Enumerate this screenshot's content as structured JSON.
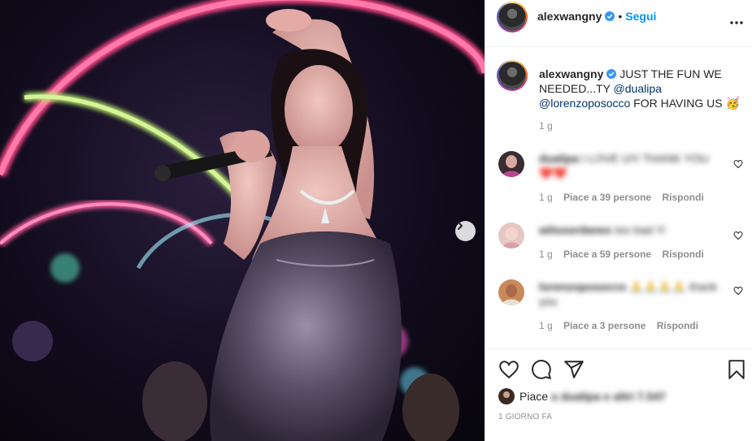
{
  "post": {
    "author": "alexwangny",
    "follow_label": "Segui",
    "separator": "•",
    "caption_text_1": "JUST THE FUN WE NEEDED...TY",
    "caption_mention_1": "@dualipa",
    "caption_mention_2": "@lorenzoposocco",
    "caption_text_2": "FOR HAVING US",
    "caption_emoji": "🥳",
    "caption_time": "1 g",
    "timestamp": "1 GIORNO FA",
    "likes_prefix": "Piace",
    "likes_blurred": "a dualipa e altri 7.547"
  },
  "comments": [
    {
      "user": "dualipa",
      "text": "I LOVE U!!! THANK YOU",
      "emoji": "❤️❤️",
      "time": "1 g",
      "likes": "Piace a 39 persone",
      "reply": "Rispondi"
    },
    {
      "user": "wilsoordanes",
      "text": "too bad !!!",
      "time": "1 g",
      "likes": "Piace a 59 persone",
      "reply": "Rispondi"
    },
    {
      "user": "lorenzoposocco",
      "text": "🙏🙏🙏🙏 thank you",
      "time": "1 g",
      "likes": "Piace a 3 persone",
      "reply": "Rispondi"
    }
  ],
  "colors": {
    "link_blue": "#0095f6",
    "mention_blue": "#00376b",
    "muted": "#8e8e8e",
    "text": "#262626",
    "verified_blue": "#3897f0"
  },
  "icons": [
    "verified-badge-icon",
    "more-options-icon",
    "next-arrow-icon",
    "heart-icon",
    "comment-icon",
    "share-icon",
    "bookmark-icon"
  ]
}
